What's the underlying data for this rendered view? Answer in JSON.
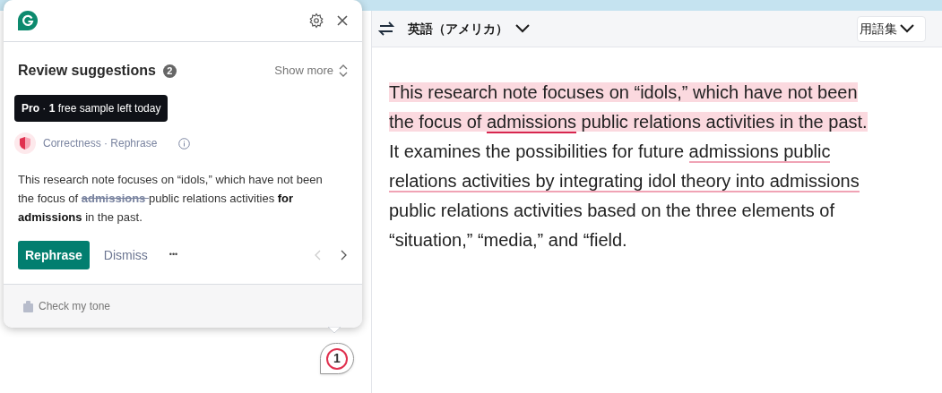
{
  "toolbar": {
    "language": "英語（アメリカ）",
    "glossary": "用語集"
  },
  "document": {
    "segments": [
      {
        "text": "This research note focuses on “idols,” which have not been the focus of ",
        "highlight": true,
        "kind": "plain"
      },
      {
        "text": "admissions",
        "highlight": true,
        "kind": "strong"
      },
      {
        "text": " public relations activities in the past.",
        "highlight": true,
        "kind": "plain"
      },
      {
        "text": " It examines the possibilities for future ",
        "highlight": false,
        "kind": "plain"
      },
      {
        "text": "admissions public relations activities by integrating idol theory into admissions",
        "highlight": false,
        "kind": "light"
      },
      {
        "text": " public relations activities based on the three elements of “situation,” “media,” and “field.",
        "highlight": false,
        "kind": "plain"
      }
    ]
  },
  "popup": {
    "title": "Review suggestions",
    "count": "2",
    "show_more": "Show more",
    "tooltip": "**Pro** · **1** free sample left today",
    "category": "Correctness · Rephrase",
    "suggestion": [
      {
        "text": "This research note focuses on “idols,” which have not been the focus of ",
        "kind": "normal"
      },
      {
        "text": "admissions ",
        "kind": "deleted"
      },
      {
        "text": "public relations activities ",
        "kind": "normal"
      },
      {
        "text": "for admissions",
        "kind": "inserted"
      },
      {
        "text": " in the past.",
        "kind": "normal"
      }
    ],
    "primary_button": "Rephrase",
    "dismiss": "Dismiss",
    "more": "•••",
    "prev_disabled": true,
    "next_disabled": false,
    "footer": "Check my tone"
  },
  "badge": {
    "count": "1"
  }
}
